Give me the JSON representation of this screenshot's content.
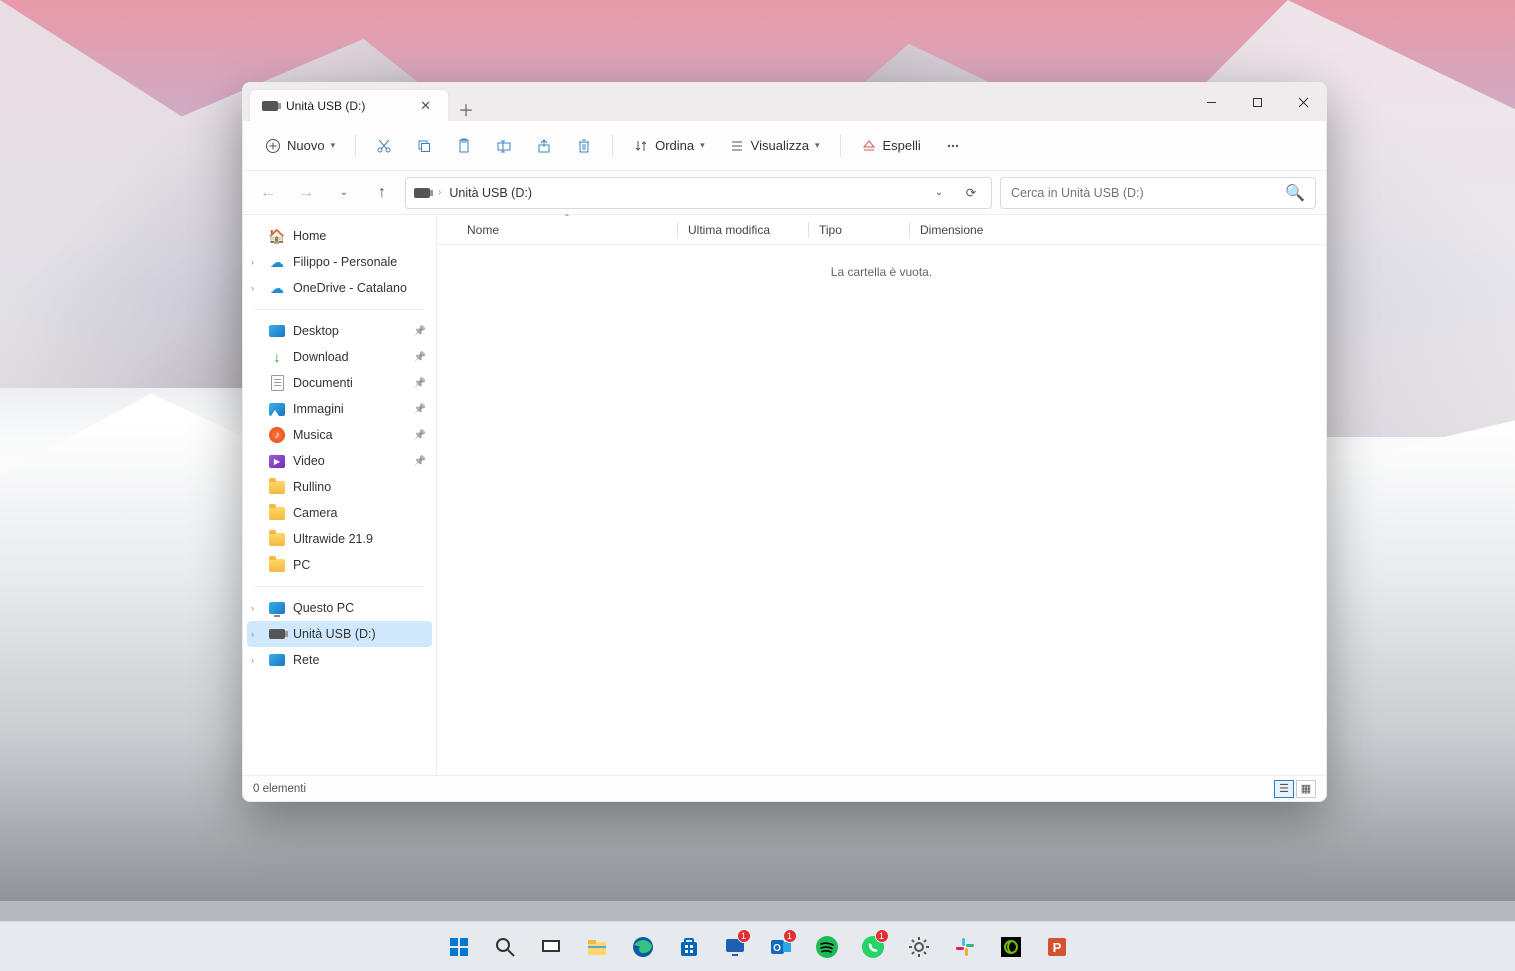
{
  "tab": {
    "title": "Unità USB (D:)"
  },
  "toolbar": {
    "new_label": "Nuovo",
    "sort_label": "Ordina",
    "view_label": "Visualizza",
    "eject_label": "Espelli"
  },
  "address": {
    "path": "Unità USB (D:)"
  },
  "search": {
    "placeholder": "Cerca in Unità USB (D:)"
  },
  "sidebar": {
    "top": [
      {
        "label": "Home",
        "icon": "home"
      },
      {
        "label": "Filippo - Personale",
        "icon": "cloud",
        "expandable": true
      },
      {
        "label": "OneDrive - Catalano",
        "icon": "cloud",
        "expandable": true
      }
    ],
    "quick": [
      {
        "label": "Desktop",
        "icon": "desktop",
        "pinned": true
      },
      {
        "label": "Download",
        "icon": "download",
        "pinned": true
      },
      {
        "label": "Documenti",
        "icon": "doc",
        "pinned": true
      },
      {
        "label": "Immagini",
        "icon": "img",
        "pinned": true
      },
      {
        "label": "Musica",
        "icon": "music",
        "pinned": true
      },
      {
        "label": "Video",
        "icon": "video",
        "pinned": true
      },
      {
        "label": "Rullino",
        "icon": "folder"
      },
      {
        "label": "Camera",
        "icon": "folder"
      },
      {
        "label": "Ultrawide 21.9",
        "icon": "folder"
      },
      {
        "label": "PC",
        "icon": "folder"
      }
    ],
    "bottom": [
      {
        "label": "Questo PC",
        "icon": "pc",
        "expandable": true
      },
      {
        "label": "Unità USB (D:)",
        "icon": "usb",
        "expandable": true,
        "selected": true
      },
      {
        "label": "Rete",
        "icon": "net",
        "expandable": true
      }
    ]
  },
  "columns": {
    "name": "Nome",
    "modified": "Ultima modifica",
    "type": "Tipo",
    "size": "Dimensione"
  },
  "content": {
    "empty_message": "La cartella è vuota."
  },
  "status": {
    "items": "0 elementi"
  },
  "taskbar": {
    "items": [
      {
        "name": "start",
        "badge": null
      },
      {
        "name": "search",
        "badge": null
      },
      {
        "name": "task-view",
        "badge": null
      },
      {
        "name": "file-explorer",
        "badge": null
      },
      {
        "name": "edge",
        "badge": null
      },
      {
        "name": "ms-store",
        "badge": null
      },
      {
        "name": "screen-app",
        "badge": "1"
      },
      {
        "name": "outlook",
        "badge": "1"
      },
      {
        "name": "spotify",
        "badge": null
      },
      {
        "name": "whatsapp",
        "badge": "1"
      },
      {
        "name": "settings",
        "badge": null
      },
      {
        "name": "slack",
        "badge": null
      },
      {
        "name": "nvidia",
        "badge": null
      },
      {
        "name": "powerpoint",
        "badge": null
      }
    ]
  }
}
